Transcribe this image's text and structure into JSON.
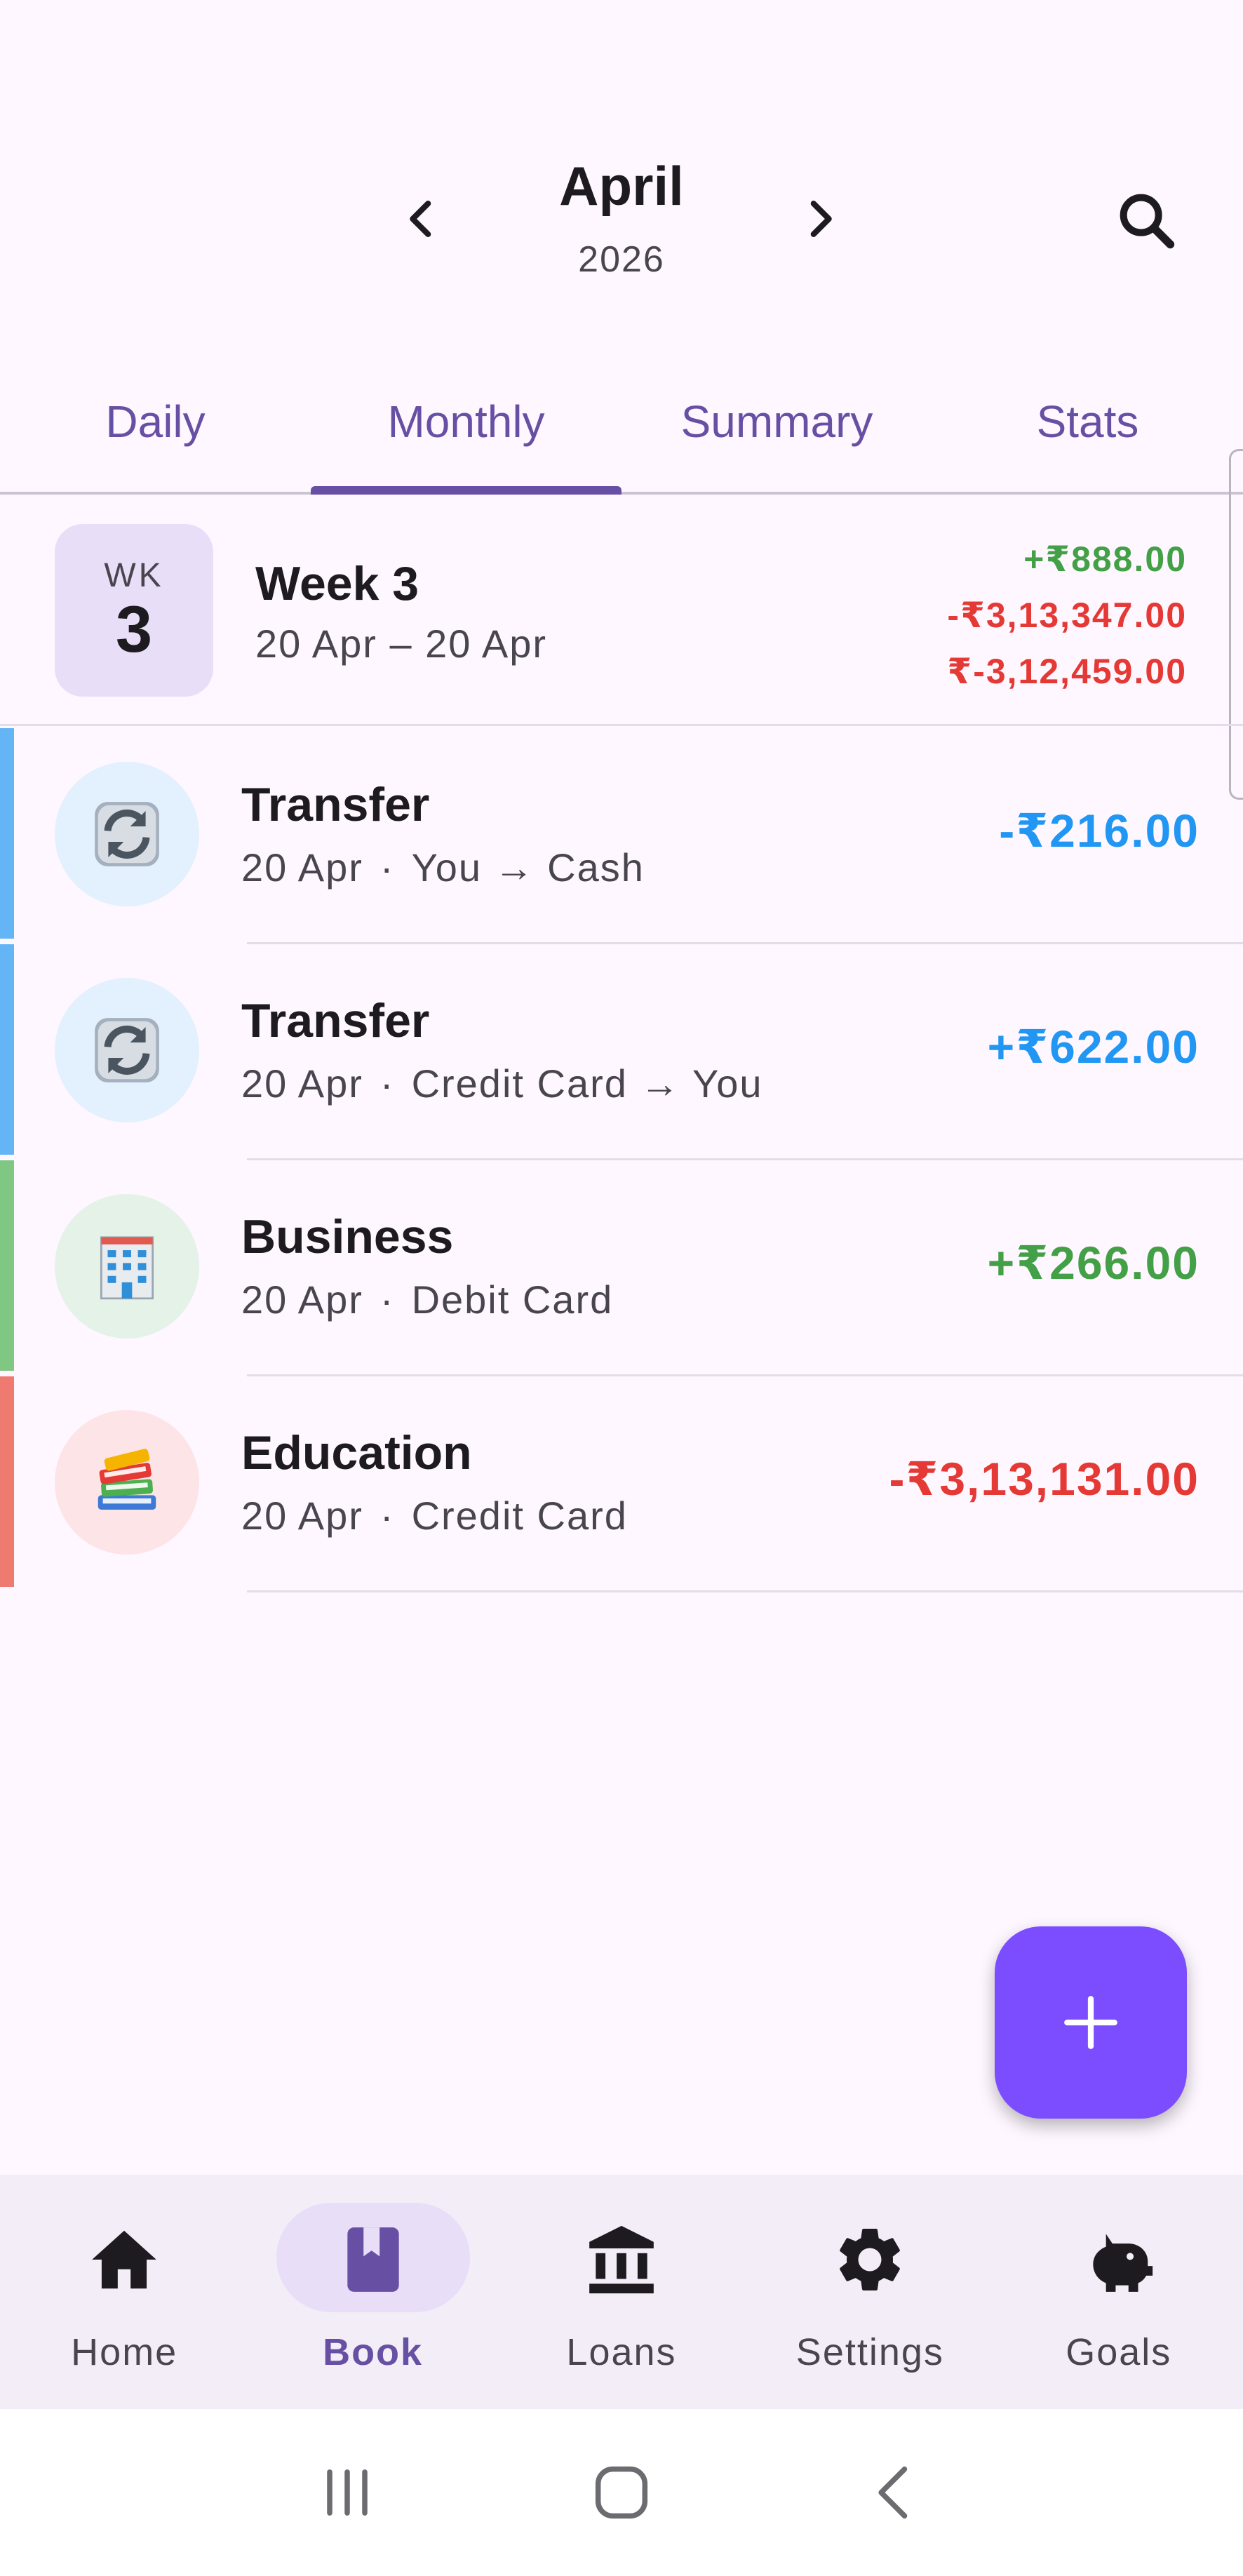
{
  "header": {
    "month": "April",
    "year": "2026",
    "prev_icon": "chevron-left-icon",
    "next_icon": "chevron-right-icon",
    "search_icon": "search-icon"
  },
  "tabs": [
    {
      "label": "Daily",
      "active": false
    },
    {
      "label": "Monthly",
      "active": true
    },
    {
      "label": "Summary",
      "active": false
    },
    {
      "label": "Stats",
      "active": false
    }
  ],
  "week": {
    "badge_label": "WK",
    "badge_number": "3",
    "title": "Week 3",
    "range": "20 Apr – 20 Apr",
    "income": "+₹888.00",
    "expense": "-₹3,13,347.00",
    "total": "₹-3,12,459.00"
  },
  "transactions": [
    {
      "title": "Transfer",
      "date": "20 Apr",
      "detail": "You → Cash",
      "amount": "-₹216.00",
      "amount_color": "#2196f3",
      "bar_color": "#64b5f6",
      "icon": "transfer-icon",
      "icon_bg": "#e3f0fd"
    },
    {
      "title": "Transfer",
      "date": "20 Apr",
      "detail": "Credit Card → You",
      "amount": "+₹622.00",
      "amount_color": "#2196f3",
      "bar_color": "#64b5f6",
      "icon": "transfer-icon",
      "icon_bg": "#e3f0fd"
    },
    {
      "title": "Business",
      "date": "20 Apr",
      "detail": "Debit Card",
      "amount": "+₹266.00",
      "amount_color": "#43a047",
      "bar_color": "#81c784",
      "icon": "office-building-icon",
      "icon_bg": "#e5f2e7"
    },
    {
      "title": "Education",
      "date": "20 Apr",
      "detail": "Credit Card",
      "amount": "-₹3,13,131.00",
      "amount_color": "#e53935",
      "bar_color": "#ef7a70",
      "icon": "books-icon",
      "icon_bg": "#fde4e6"
    }
  ],
  "meta_separator": "·",
  "fab": {
    "icon": "plus-icon",
    "color": "#7c4dff"
  },
  "bottom_nav": [
    {
      "label": "Home",
      "icon": "home-icon",
      "active": false
    },
    {
      "label": "Book",
      "icon": "book-icon",
      "active": true
    },
    {
      "label": "Loans",
      "icon": "bank-icon",
      "active": false
    },
    {
      "label": "Settings",
      "icon": "gear-icon",
      "active": false
    },
    {
      "label": "Goals",
      "icon": "piggy-bank-icon",
      "active": false
    }
  ],
  "colors": {
    "accent": "#6750a4",
    "income": "#43a047",
    "expense": "#e53935",
    "transfer": "#2196f3"
  }
}
